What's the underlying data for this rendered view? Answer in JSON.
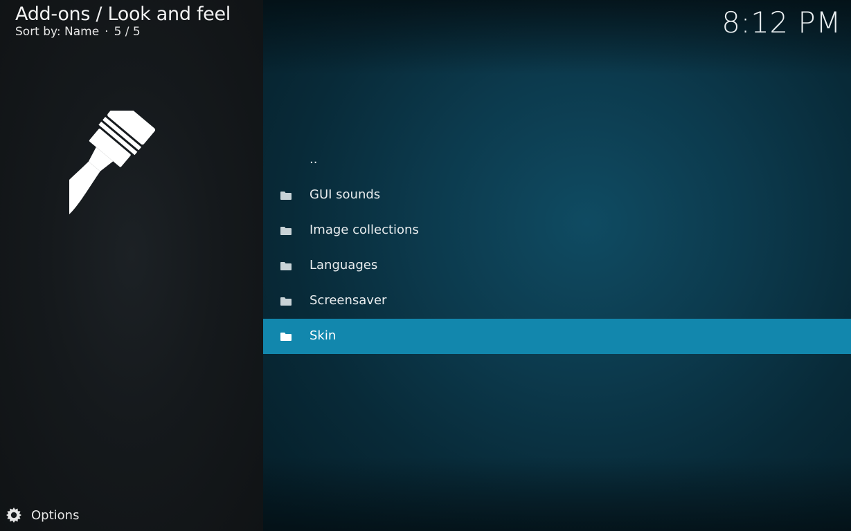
{
  "header": {
    "title": "Add-ons / Look and feel",
    "sort_label": "Sort by: Name",
    "separator": "·",
    "count": "5 / 5"
  },
  "clock": "8:12 PM",
  "left_panel": {
    "category_icon": "paintbrush-icon"
  },
  "list": {
    "parent_item": "..",
    "items": [
      {
        "label": "GUI sounds",
        "icon": "folder-icon"
      },
      {
        "label": "Image collections",
        "icon": "folder-icon"
      },
      {
        "label": "Languages",
        "icon": "folder-icon"
      },
      {
        "label": "Screensaver",
        "icon": "folder-icon"
      },
      {
        "label": "Skin",
        "icon": "folder-icon",
        "selected": true
      }
    ]
  },
  "options": {
    "label": "Options",
    "icon": "gear-icon"
  },
  "colors": {
    "selection": "#1287ad",
    "left_panel": "#15191c",
    "right_panel": "#0c3a4d"
  }
}
